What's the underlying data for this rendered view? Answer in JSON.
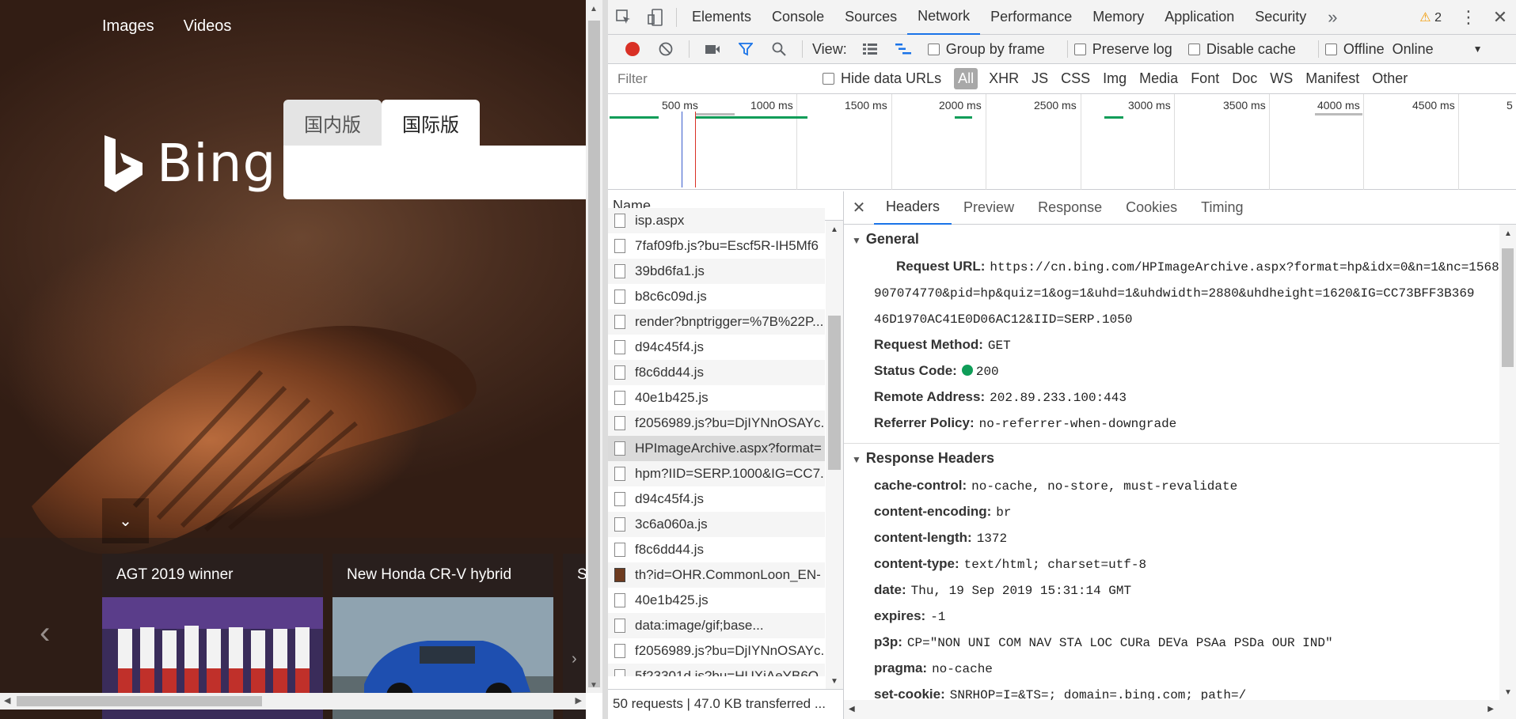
{
  "bing": {
    "nav": [
      "Images",
      "Videos"
    ],
    "logo_text": "Bing",
    "tab_cn": "国内版",
    "tab_intl": "国际版",
    "cards": [
      {
        "title": "AGT 2019 winner"
      },
      {
        "title": "New Honda CR-V hybrid"
      },
      {
        "title": "S"
      }
    ]
  },
  "devtools": {
    "tabs": [
      "Elements",
      "Console",
      "Sources",
      "Network",
      "Performance",
      "Memory",
      "Application",
      "Security"
    ],
    "active_tab": "Network",
    "warning_count": "2",
    "toolbar": {
      "view_label": "View:",
      "group_by_frame": "Group by frame",
      "preserve_log": "Preserve log",
      "disable_cache": "Disable cache",
      "offline": "Offline",
      "throttle": "Online"
    },
    "filter": {
      "placeholder": "Filter",
      "hide_data_urls": "Hide data URLs",
      "types": [
        "All",
        "XHR",
        "JS",
        "CSS",
        "Img",
        "Media",
        "Font",
        "Doc",
        "WS",
        "Manifest",
        "Other"
      ]
    },
    "timeline": {
      "ticks": [
        "500 ms",
        "1000 ms",
        "1500 ms",
        "2000 ms",
        "2500 ms",
        "3000 ms",
        "3500 ms",
        "4000 ms",
        "4500 ms",
        "5"
      ]
    },
    "requests": {
      "header": "Name",
      "rows": [
        "isp.aspx",
        "7faf09fb.js?bu=Escf5R-IH5Mf6",
        "39bd6fa1.js",
        "b8c6c09d.js",
        "render?bnptrigger=%7B%22P...",
        "d94c45f4.js",
        "f8c6dd44.js",
        "40e1b425.js",
        "f2056989.js?bu=DjIYNnOSAYc...",
        "HPImageArchive.aspx?format=",
        "hpm?IID=SERP.1000&IG=CC7...",
        "d94c45f4.js",
        "3c6a060a.js",
        "f8c6dd44.js",
        "th?id=OHR.CommonLoon_EN-",
        "40e1b425.js",
        "data:image/gif;base...",
        "f2056989.js?bu=DjIYNnOSAYc...",
        "5f23301d.js?bu=HUXiAeYB6O"
      ],
      "summary": "50 requests  |  47.0 KB transferred  ..."
    },
    "detail": {
      "tabs": [
        "Headers",
        "Preview",
        "Response",
        "Cookies",
        "Timing"
      ],
      "general": {
        "title": "General",
        "request_url_label": "Request URL:",
        "request_url_1": "https://cn.bing.com/HPImageArchive.aspx?format=hp&idx=0&n=1&nc=1568",
        "request_url_2": "907074770&pid=hp&quiz=1&og=1&uhd=1&uhdwidth=2880&uhdheight=1620&IG=CC73BFF3B369",
        "request_url_3": "46D1970AC41E0D06AC12&IID=SERP.1050",
        "method_label": "Request Method:",
        "method": "GET",
        "status_label": "Status Code:",
        "status": "200",
        "remote_label": "Remote Address:",
        "remote": "202.89.233.100:443",
        "referrer_label": "Referrer Policy:",
        "referrer": "no-referrer-when-downgrade"
      },
      "response_headers": {
        "title": "Response Headers",
        "items": [
          {
            "k": "cache-control:",
            "v": "no-cache, no-store, must-revalidate"
          },
          {
            "k": "content-encoding:",
            "v": "br"
          },
          {
            "k": "content-length:",
            "v": "1372"
          },
          {
            "k": "content-type:",
            "v": "text/html; charset=utf-8"
          },
          {
            "k": "date:",
            "v": "Thu, 19 Sep 2019 15:31:14 GMT"
          },
          {
            "k": "expires:",
            "v": "-1"
          },
          {
            "k": "p3p:",
            "v": "CP=\"NON UNI COM NAV STA LOC CURa DEVa PSAa PSDa OUR IND\""
          },
          {
            "k": "pragma:",
            "v": "no-cache"
          },
          {
            "k": "set-cookie:",
            "v": "SNRHOP=I=&TS=; domain=.bing.com; path=/"
          }
        ]
      }
    }
  }
}
